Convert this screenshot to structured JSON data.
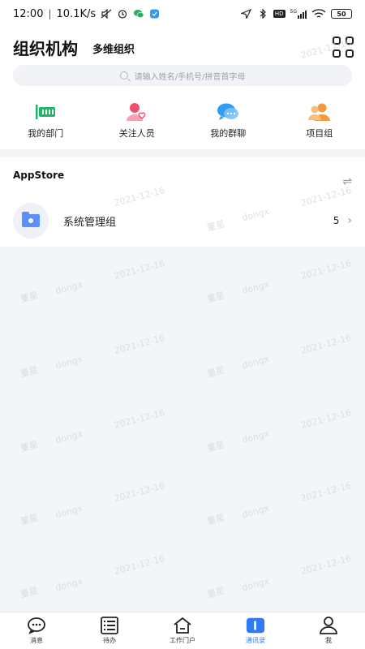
{
  "status_bar": {
    "time": "12:00",
    "speed": "10.1K/s",
    "battery": "50",
    "signal_label": "5G",
    "hd_label": "HD"
  },
  "header": {
    "title": "组织机构",
    "subtitle": "多维组织",
    "search_placeholder": "请输入姓名/手机号/拼音首字母"
  },
  "quick_actions": [
    {
      "label": "我的部门",
      "icon": "department-icon",
      "color": "#22b26a"
    },
    {
      "label": "关注人员",
      "icon": "follow-person-icon",
      "color": "#f0506e"
    },
    {
      "label": "我的群聊",
      "icon": "group-chat-icon",
      "color": "#2f9cf0"
    },
    {
      "label": "项目组",
      "icon": "project-group-icon",
      "color": "#f59a3c"
    }
  ],
  "section": {
    "title": "AppStore",
    "group": {
      "name": "系统管理组",
      "count": "5"
    }
  },
  "watermarks": [
    "2021-12-16",
    "董星",
    "dongx"
  ],
  "tabs": [
    {
      "label": "消息",
      "icon": "message-icon"
    },
    {
      "label": "待办",
      "icon": "todo-list-icon"
    },
    {
      "label": "工作门户",
      "icon": "home-portal-icon"
    },
    {
      "label": "通讯录",
      "icon": "contacts-icon",
      "active": true
    },
    {
      "label": "我",
      "icon": "profile-icon"
    }
  ],
  "colors": {
    "accent": "#2f7bf6"
  }
}
